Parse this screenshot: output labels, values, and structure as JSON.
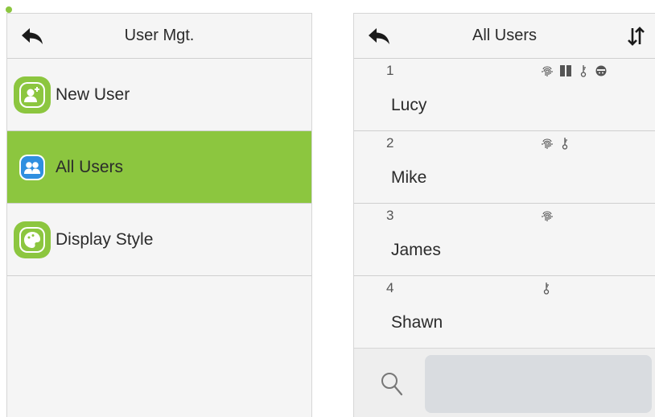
{
  "user_mgt": {
    "title": "User Mgt.",
    "items": [
      {
        "label": "New User",
        "icon": "add-user-icon",
        "active": false
      },
      {
        "label": "All Users",
        "icon": "users-icon",
        "active": true
      },
      {
        "label": "Display Style",
        "icon": "palette-icon",
        "active": false
      }
    ]
  },
  "all_users": {
    "title": "All Users",
    "users": [
      {
        "id": "1",
        "name": "Lucy",
        "credentials": [
          "fingerprint-icon",
          "card-icon",
          "password-icon",
          "face-icon"
        ]
      },
      {
        "id": "2",
        "name": "Mike",
        "credentials": [
          "fingerprint-icon",
          "password-icon"
        ]
      },
      {
        "id": "3",
        "name": "James",
        "credentials": [
          "fingerprint-icon"
        ]
      },
      {
        "id": "4",
        "name": "Shawn",
        "credentials": [
          "password-icon"
        ]
      }
    ],
    "search": {
      "placeholder": "",
      "value": ""
    }
  },
  "colors": {
    "accent": "#8cc63f",
    "background": "#f5f5f5",
    "divider": "#cfcfcf",
    "search_field": "#d9dce0"
  }
}
